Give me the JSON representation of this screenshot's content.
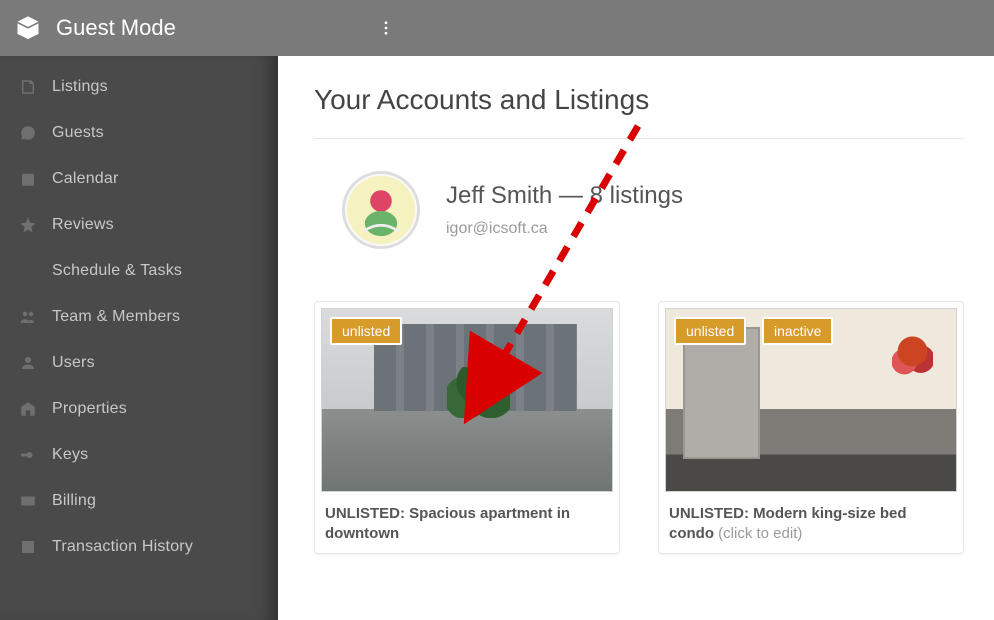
{
  "topbar": {
    "title": "Guest Mode"
  },
  "sidebar": {
    "items": [
      {
        "label": "Listings",
        "icon": "listings-icon"
      },
      {
        "label": "Guests",
        "icon": "guests-icon"
      },
      {
        "label": "Calendar",
        "icon": "calendar-icon"
      },
      {
        "label": "Reviews",
        "icon": "star-icon"
      },
      {
        "label": "Schedule & Tasks",
        "icon": "schedule-icon"
      },
      {
        "label": "Team & Members",
        "icon": "team-icon"
      },
      {
        "label": "Users",
        "icon": "users-icon"
      },
      {
        "label": "Properties",
        "icon": "properties-icon"
      },
      {
        "label": "Keys",
        "icon": "keys-icon"
      },
      {
        "label": "Billing",
        "icon": "billing-icon"
      },
      {
        "label": "Transaction History",
        "icon": "transactions-icon"
      }
    ]
  },
  "main": {
    "page_title": "Your Accounts and Listings",
    "account": {
      "display_name": "Jeff Smith — 8 listings",
      "email": "igor@icsoft.ca"
    },
    "listings": [
      {
        "badges": [
          "unlisted"
        ],
        "title_strong": "UNLISTED: Spacious apartment in downtown",
        "title_muted": ""
      },
      {
        "badges": [
          "unlisted",
          "inactive"
        ],
        "title_strong": "UNLISTED: Modern king-size bed condo",
        "title_muted": " (click to edit)"
      }
    ]
  },
  "colors": {
    "badge": "#d79b2a",
    "sidebar": "#4a4a4a",
    "topbar": "#7a7a7a"
  }
}
